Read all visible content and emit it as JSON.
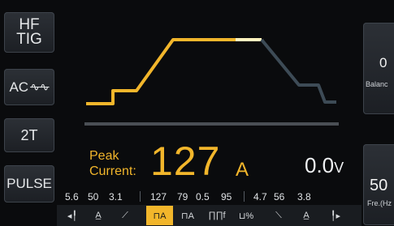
{
  "left_buttons": {
    "hf_line1": "HF",
    "hf_line2": "TIG",
    "ac": "AC",
    "ac_wave": "∿∿",
    "trigger": "2T",
    "pulse": "PULSE"
  },
  "right_buttons": {
    "balance_value": "0",
    "balance_label": "Balanc",
    "frequency_value": "50",
    "frequency_label": "Fre.(Hz"
  },
  "readout": {
    "peak_label_line1": "Peak",
    "peak_label_line2": "Current:",
    "peak_value": "127",
    "peak_unit": "A",
    "voltage_value": "0.0",
    "voltage_unit": "V"
  },
  "params": [
    "5.6",
    "50",
    "3.1",
    "127",
    "79",
    "0.5",
    "95",
    "4.7",
    "56",
    "3.8"
  ],
  "param_icons": [
    {
      "name": "pre-gas-icon",
      "glyph": "◂╿",
      "active": false
    },
    {
      "name": "start-current-icon",
      "glyph": "A̲",
      "active": false
    },
    {
      "name": "upslope-icon",
      "glyph": "⟋",
      "active": false
    },
    {
      "name": "peak-current-icon",
      "glyph": "⊓A",
      "active": true
    },
    {
      "name": "base-current-icon",
      "glyph": "⊓A",
      "active": false
    },
    {
      "name": "pulse-frequency-icon",
      "glyph": "∏∏f",
      "active": false
    },
    {
      "name": "pulse-duty-icon",
      "glyph": "⊔%",
      "active": false
    },
    {
      "name": "downslope-icon",
      "glyph": "⟍",
      "active": false
    },
    {
      "name": "crater-current-icon",
      "glyph": "A̲",
      "active": false
    },
    {
      "name": "post-gas-icon",
      "glyph": "╿▸",
      "active": false
    }
  ],
  "colors": {
    "accent": "#f2b62b",
    "curve_inactive": "#3d4b56",
    "background": "#0a0b0d"
  }
}
